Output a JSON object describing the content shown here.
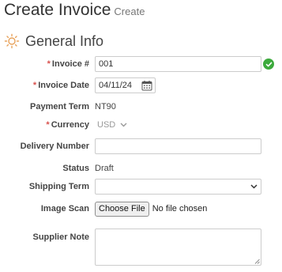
{
  "header": {
    "title": "Create Invoice",
    "subtitle": "Create"
  },
  "section": {
    "title": "General Info",
    "icon": "sun-settings-icon",
    "accent": "#e8a25b"
  },
  "form": {
    "invoice_number": {
      "label": "Invoice #",
      "required": "*",
      "value": "001",
      "valid_icon": "check-circle-icon",
      "valid_color": "#3caa3c"
    },
    "invoice_date": {
      "label": "Invoice Date",
      "required": "*",
      "value": "04/11/24",
      "icon": "calendar-icon"
    },
    "payment_term": {
      "label": "Payment Term",
      "value": "NT90"
    },
    "currency": {
      "label": "Currency",
      "required": "*",
      "value": "USD",
      "icon": "chevron-down-icon"
    },
    "delivery_number": {
      "label": "Delivery Number",
      "value": ""
    },
    "status": {
      "label": "Status",
      "value": "Draft"
    },
    "shipping_term": {
      "label": "Shipping Term",
      "value": "",
      "icon": "chevron-down-icon"
    },
    "image_scan": {
      "label": "Image Scan",
      "button": "Choose File",
      "file_text": "No file chosen"
    },
    "supplier_note": {
      "label": "Supplier Note",
      "value": ""
    }
  }
}
